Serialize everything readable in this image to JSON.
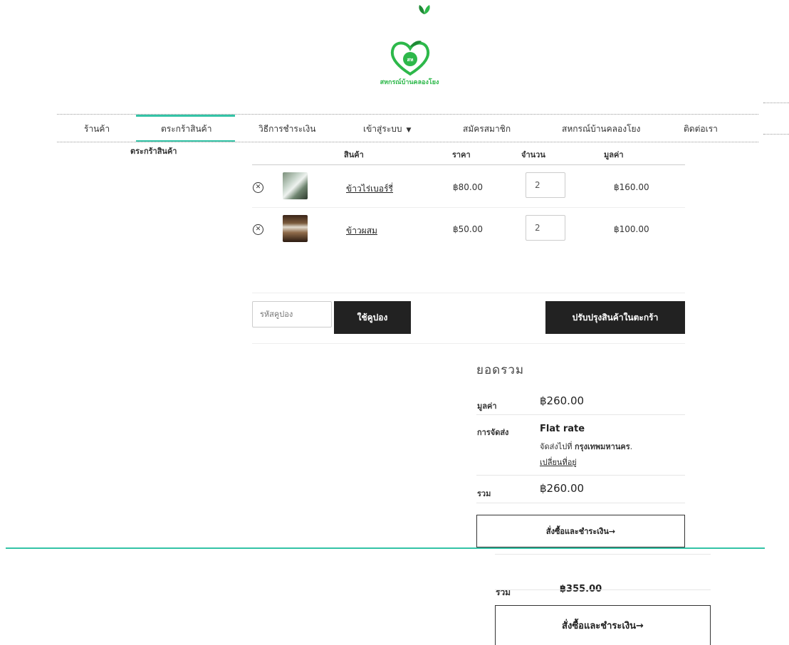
{
  "site": {
    "logo_text": "สหกรณ์บ้านคลองโยง",
    "logo_monogram": "สห"
  },
  "nav": {
    "items": [
      {
        "label": "ร้านค้า"
      },
      {
        "label": "ตระกร้าสินค้า"
      },
      {
        "label": "วิธีการชำระเงิน"
      },
      {
        "label": "เข้าสู่ระบบ"
      },
      {
        "label": "สมัครสมาชิก"
      },
      {
        "label": "สหกรณ์บ้านคลองโยง"
      },
      {
        "label": "ติดต่อเรา"
      }
    ],
    "active_color": "#33c3a6"
  },
  "breadcrumb": "ตระกร้าสินค้า",
  "cart": {
    "headers": {
      "product": "สินค้า",
      "price": "ราคา",
      "quantity": "จำนวน",
      "subtotal": "มูลค่า"
    },
    "items": [
      {
        "name": "ข้าวไร่เบอร์รี่",
        "price": "฿80.00",
        "qty": "2",
        "subtotal": "฿160.00"
      },
      {
        "name": "ข้าวผสม",
        "price": "฿50.00",
        "qty": "2",
        "subtotal": "฿100.00"
      }
    ],
    "coupon_placeholder": "รหัสคูปอง",
    "apply_coupon": "ใช้คูปอง",
    "update_cart": "ปรับปรุงสินค้าในตะกร้า"
  },
  "totals": {
    "title": "ยอดรวม",
    "subtotal_label": "มูลค่า",
    "subtotal_value": "฿260.00",
    "shipping_label": "การจัดส่ง",
    "shipping_method": "Flat rate",
    "shipping_to_prefix": "จัดส่งไปที่",
    "shipping_to_place": "กรุงเทพมหานคร",
    "change_address": "เปลี่ยนที่อยู่",
    "total_label": "รวม",
    "total_value": "฿260.00",
    "checkout": "สั่งซื้อและชำระเงิน→"
  },
  "overlay": {
    "total_label": "รวม",
    "total_value": "฿355.00",
    "checkout": "สั่งซื้อและชำระเงิน→"
  }
}
